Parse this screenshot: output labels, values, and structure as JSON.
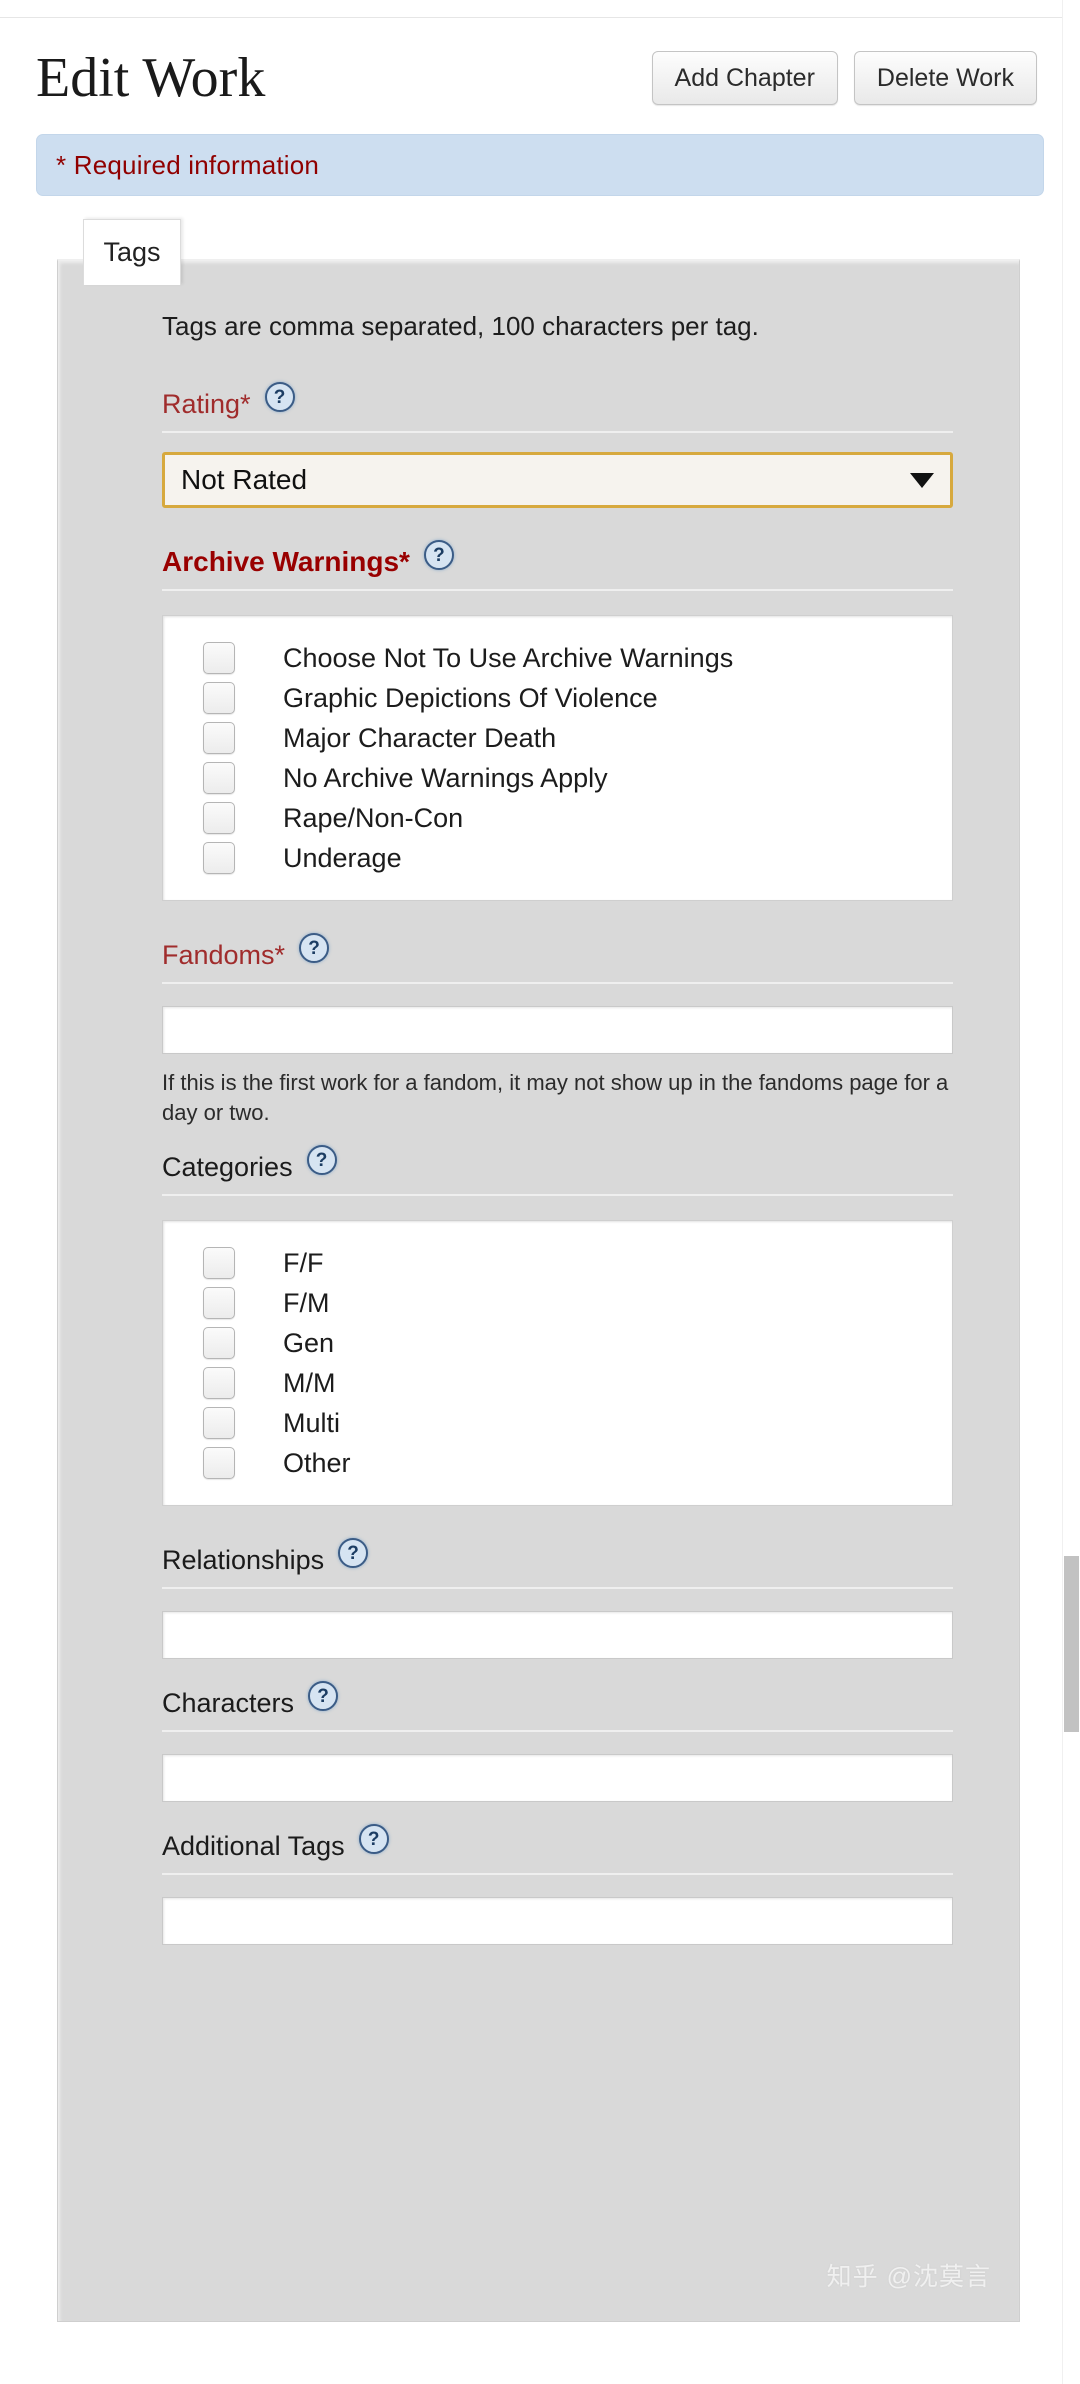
{
  "header": {
    "title": "Edit Work",
    "buttons": [
      {
        "label": "Add Chapter",
        "name": "add-chapter-button"
      },
      {
        "label": "Delete Work",
        "name": "delete-work-button"
      }
    ]
  },
  "notice": {
    "text": "* Required information",
    "background_color": "#cddef0",
    "text_color": "#900000"
  },
  "tabs": [
    {
      "label": "Tags",
      "active": true
    }
  ],
  "form": {
    "intro": "Tags are comma separated, 100 characters per tag.",
    "help_icon": "?",
    "rating": {
      "label": "Rating*",
      "required": true,
      "selected": "Not Rated",
      "options": [
        "Not Rated"
      ],
      "border_color": "#d7a93e",
      "caret": "dropdown-caret"
    },
    "archive_warnings": {
      "label": "Archive Warnings*",
      "required": true,
      "items": [
        {
          "label": "Choose Not To Use Archive Warnings",
          "checked": false
        },
        {
          "label": "Graphic Depictions Of Violence",
          "checked": false
        },
        {
          "label": "Major Character Death",
          "checked": false
        },
        {
          "label": "No Archive Warnings Apply",
          "checked": false
        },
        {
          "label": "Rape/Non-Con",
          "checked": false
        },
        {
          "label": "Underage",
          "checked": false
        }
      ]
    },
    "fandoms": {
      "label": "Fandoms*",
      "required": true,
      "value": "",
      "hint": "If this is the first work for a fandom, it may not show up in the fandoms page for a day or two."
    },
    "categories": {
      "label": "Categories",
      "required": false,
      "items": [
        {
          "label": "F/F",
          "checked": false
        },
        {
          "label": "F/M",
          "checked": false
        },
        {
          "label": "Gen",
          "checked": false
        },
        {
          "label": "M/M",
          "checked": false
        },
        {
          "label": "Multi",
          "checked": false
        },
        {
          "label": "Other",
          "checked": false
        }
      ]
    },
    "relationships": {
      "label": "Relationships",
      "value": ""
    },
    "characters": {
      "label": "Characters",
      "value": ""
    },
    "additional_tags": {
      "label": "Additional Tags",
      "value": ""
    }
  },
  "watermark": "知乎 @沈莫言"
}
